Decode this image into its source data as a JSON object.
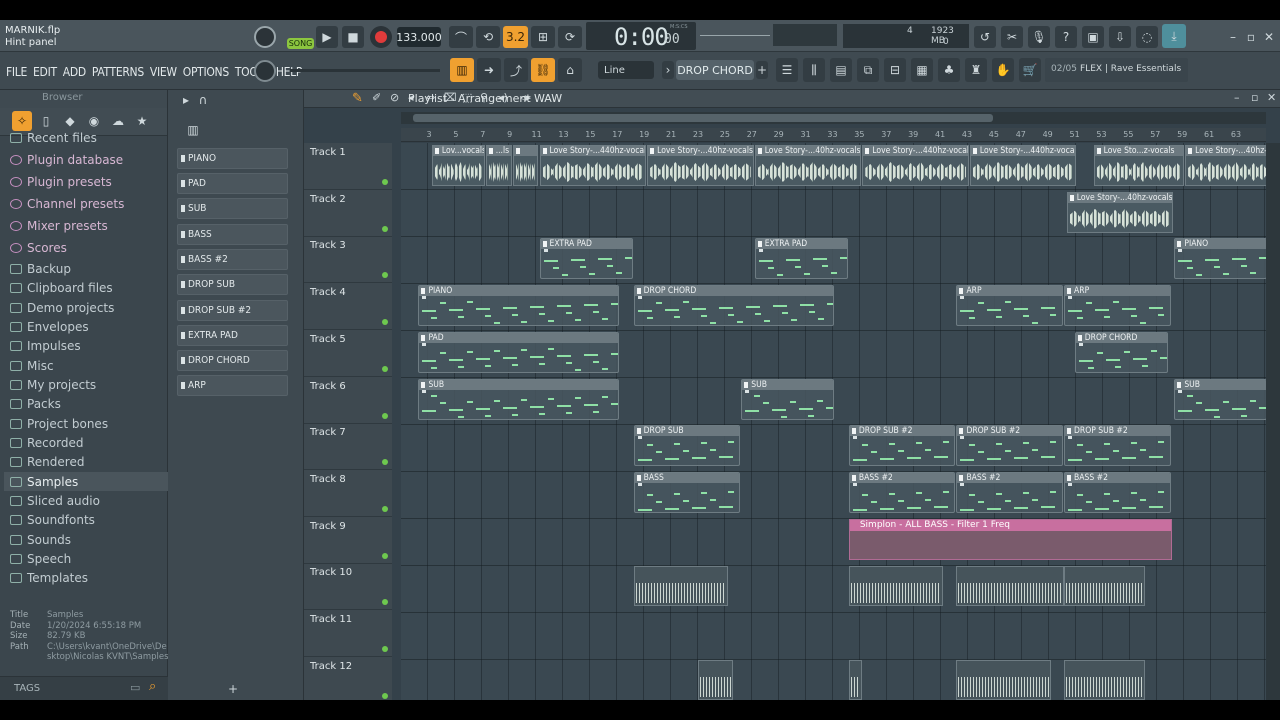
{
  "project": {
    "file": "MARNIK.flp",
    "hint": "Hint panel"
  },
  "transport": {
    "song_label": "SONG",
    "tempo": "133.000",
    "time": "0:00",
    "time_sub": "00",
    "time_units": "M:S:CS",
    "cpu": "4",
    "memory": "1923 MB",
    "memory_sub": "0"
  },
  "menu": [
    "FILE",
    "EDIT",
    "ADD",
    "PATTERNS",
    "VIEW",
    "OPTIONS",
    "TOOLS",
    "HELP"
  ],
  "toolbar": {
    "snap": "Line",
    "pattern": "DROP CHORD",
    "news": "02/05",
    "news_text": "FLEX | Rave Essentials",
    "step": "3.2"
  },
  "browser": {
    "title": "Browser",
    "items": [
      "Recent files",
      "Plugin database",
      "Plugin presets",
      "Channel presets",
      "Mixer presets",
      "Scores",
      "Backup",
      "Clipboard files",
      "Demo projects",
      "Envelopes",
      "Impulses",
      "Misc",
      "My projects",
      "Packs",
      "Project bones",
      "Recorded",
      "Rendered",
      "Samples",
      "Sliced audio",
      "Soundfonts",
      "Sounds",
      "Speech",
      "Templates"
    ],
    "info": {
      "Title": "Samples",
      "Date": "1/20/2024 6:55:18 PM",
      "Size": "82.79 KB",
      "Path": "C:\\Users\\kvant\\OneDrive\\Desktop\\Nicolas KVNT\\Samples"
    },
    "tags": "TAGS"
  },
  "patterns": [
    "PIANO",
    "PAD",
    "SUB",
    "BASS",
    "BASS #2",
    "DROP SUB",
    "DROP SUB #2",
    "EXTRA PAD",
    "DROP CHORD",
    "ARP"
  ],
  "playlist": {
    "title": "Playlist - Arrangement",
    "crumb": "WAW",
    "tracks": [
      "Track 1",
      "Track 2",
      "Track 3",
      "Track 4",
      "Track 5",
      "Track 6",
      "Track 7",
      "Track 8",
      "Track 9",
      "Track 10",
      "Track 11",
      "Track 12"
    ],
    "ruler": [
      "3",
      "5",
      "7",
      "9",
      "11",
      "13",
      "15",
      "17",
      "19",
      "21",
      "23",
      "25",
      "27",
      "29",
      "31",
      "33",
      "35",
      "37",
      "39",
      "41",
      "43",
      "45",
      "47",
      "49",
      "51",
      "53",
      "55",
      "57",
      "59",
      "61",
      "63"
    ],
    "audio_clips": [
      {
        "track": 0,
        "start": 1,
        "len": 2,
        "label": "Lov...vocals"
      },
      {
        "track": 0,
        "start": 3,
        "len": 1,
        "label": "...ls"
      },
      {
        "track": 0,
        "start": 4,
        "len": 1,
        "label": ""
      },
      {
        "track": 0,
        "start": 5,
        "len": 4,
        "label": "Love Story-...440hz-vocals"
      },
      {
        "track": 0,
        "start": 9,
        "len": 4,
        "label": "Love Story-...40hz-vocals"
      },
      {
        "track": 0,
        "start": 13,
        "len": 4,
        "label": "Love Story-...40hz-vocals"
      },
      {
        "track": 0,
        "start": 17,
        "len": 4,
        "label": "Love Story-...440hz-vocals"
      },
      {
        "track": 0,
        "start": 21,
        "len": 4,
        "label": "Love Story-...440hz-vocals"
      },
      {
        "track": 0,
        "start": 25,
        "len": 0,
        "label": ""
      },
      {
        "track": 0,
        "start": 25.6,
        "len": 3.4,
        "label": "Love Sto...z-vocals"
      },
      {
        "track": 0,
        "start": 29,
        "len": 3.5,
        "label": "Love Story-...40hz-vocals"
      },
      {
        "track": 1,
        "start": 24.6,
        "len": 4,
        "label": "Love Story-...40hz-vocals"
      }
    ],
    "pattern_clips": [
      {
        "track": 2,
        "start": 5,
        "len": 3.5,
        "label": "EXTRA PAD"
      },
      {
        "track": 2,
        "start": 13,
        "len": 3.5,
        "label": "EXTRA PAD"
      },
      {
        "track": 2,
        "start": 28.6,
        "len": 3.5,
        "label": "PIANO"
      },
      {
        "track": 3,
        "start": 0.5,
        "len": 7.5,
        "label": "PIANO"
      },
      {
        "track": 3,
        "start": 8.5,
        "len": 7.5,
        "label": "DROP CHORD"
      },
      {
        "track": 3,
        "start": 20.5,
        "len": 4,
        "label": "ARP"
      },
      {
        "track": 3,
        "start": 24.5,
        "len": 4,
        "label": "ARP"
      },
      {
        "track": 4,
        "start": 0.5,
        "len": 7.5,
        "label": "PAD"
      },
      {
        "track": 4,
        "start": 24.9,
        "len": 3.5,
        "label": "DROP CHORD"
      },
      {
        "track": 5,
        "start": 0.5,
        "len": 7.5,
        "label": "SUB"
      },
      {
        "track": 5,
        "start": 12.5,
        "len": 3.5,
        "label": "SUB"
      },
      {
        "track": 5,
        "start": 28.6,
        "len": 3.5,
        "label": "SUB"
      },
      {
        "track": 6,
        "start": 8.5,
        "len": 4,
        "label": "DROP SUB"
      },
      {
        "track": 6,
        "start": 16.5,
        "len": 4,
        "label": "DROP SUB #2"
      },
      {
        "track": 6,
        "start": 20.5,
        "len": 4,
        "label": "DROP SUB #2"
      },
      {
        "track": 6,
        "start": 24.5,
        "len": 4,
        "label": "DROP SUB #2"
      },
      {
        "track": 7,
        "start": 8.5,
        "len": 4,
        "label": "BASS"
      },
      {
        "track": 7,
        "start": 16.5,
        "len": 4,
        "label": "BASS #2"
      },
      {
        "track": 7,
        "start": 20.5,
        "len": 4,
        "label": "BASS #2"
      },
      {
        "track": 7,
        "start": 24.5,
        "len": 4,
        "label": "BASS #2"
      }
    ],
    "automation": {
      "track": 8,
      "start": 16.5,
      "len": 12,
      "label": "Simplon - ALL BASS - Filter 1 Freq"
    }
  },
  "colors": {
    "accent_orange": "#f0a030",
    "record_red": "#e03b3b",
    "led_green": "#6ec84f",
    "automation": "#c86f9f"
  }
}
